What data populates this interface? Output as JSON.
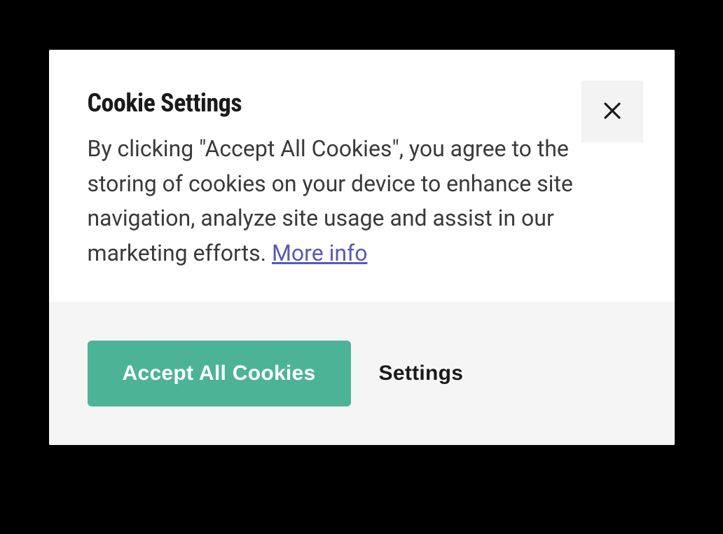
{
  "modal": {
    "title": "Cookie Settings",
    "description": "By clicking \"Accept All Cookies\", you agree to the storing of cookies on your device to enhance site navigation, analyze site usage and assist in our marketing efforts. ",
    "moreInfoLabel": "More info",
    "footer": {
      "acceptLabel": "Accept All Cookies",
      "settingsLabel": "Settings"
    },
    "icons": {
      "close": "close-icon"
    },
    "colors": {
      "accent": "#4db396",
      "link": "#5959b5",
      "footerBg": "#f5f5f5",
      "closeBg": "#f3f3f3"
    }
  }
}
